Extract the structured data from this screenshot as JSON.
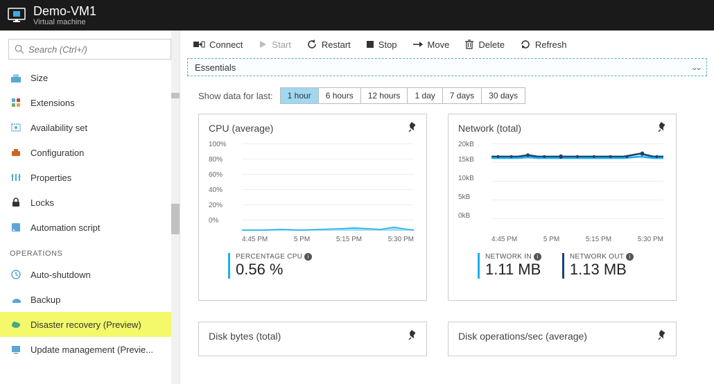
{
  "header": {
    "title": "Demo-VM1",
    "subtitle": "Virtual machine"
  },
  "search": {
    "placeholder": "Search (Ctrl+/)"
  },
  "sidebar": {
    "items": [
      {
        "label": "Size"
      },
      {
        "label": "Extensions"
      },
      {
        "label": "Availability set"
      },
      {
        "label": "Configuration"
      },
      {
        "label": "Properties"
      },
      {
        "label": "Locks"
      },
      {
        "label": "Automation script"
      }
    ],
    "opsHeader": "OPERATIONS",
    "ops": [
      {
        "label": "Auto-shutdown"
      },
      {
        "label": "Backup"
      },
      {
        "label": "Disaster recovery (Preview)",
        "hl": true
      },
      {
        "label": "Update management (Previe..."
      }
    ]
  },
  "toolbar": {
    "connect": "Connect",
    "start": "Start",
    "restart": "Restart",
    "stop": "Stop",
    "move": "Move",
    "delete": "Delete",
    "refresh": "Refresh"
  },
  "essentials": {
    "label": "Essentials"
  },
  "timerange": {
    "label": "Show data for last:",
    "options": [
      "1 hour",
      "6 hours",
      "12 hours",
      "1 day",
      "7 days",
      "30 days"
    ],
    "active": 0
  },
  "cards": {
    "cpu": {
      "title": "CPU (average)",
      "metricName": "PERCENTAGE CPU",
      "metricValue": "0.56 %"
    },
    "net": {
      "title": "Network (total)",
      "inName": "NETWORK IN",
      "inValue": "1.11 MB",
      "outName": "NETWORK OUT",
      "outValue": "1.13 MB"
    },
    "disk1": {
      "title": "Disk bytes (total)"
    },
    "disk2": {
      "title": "Disk operations/sec (average)"
    }
  },
  "chart_data": [
    {
      "type": "line",
      "title": "CPU (average)",
      "ylabel": "",
      "ylim": [
        0,
        100
      ],
      "yticks": [
        "100%",
        "80%",
        "60%",
        "40%",
        "20%",
        "0%"
      ],
      "x": [
        "4:45 PM",
        "5 PM",
        "5:15 PM",
        "5:30 PM"
      ],
      "series": [
        {
          "name": "PERCENTAGE CPU",
          "values": [
            0.5,
            0.5,
            1.5,
            1.2,
            0.8,
            2.5,
            1.0,
            0.6
          ]
        }
      ]
    },
    {
      "type": "line",
      "title": "Network (total)",
      "ylabel": "",
      "ylim": [
        0,
        20
      ],
      "yticks": [
        "20kB",
        "15kB",
        "10kB",
        "5kB",
        "0kB"
      ],
      "x": [
        "4:45 PM",
        "5 PM",
        "5:15 PM",
        "5:30 PM"
      ],
      "series": [
        {
          "name": "NETWORK IN",
          "values": [
            17,
            17,
            17.2,
            17,
            17,
            17,
            17.5,
            17
          ]
        },
        {
          "name": "NETWORK OUT",
          "values": [
            17.3,
            17.3,
            17.5,
            17.3,
            17.3,
            17.3,
            18,
            17.3
          ]
        }
      ]
    }
  ]
}
